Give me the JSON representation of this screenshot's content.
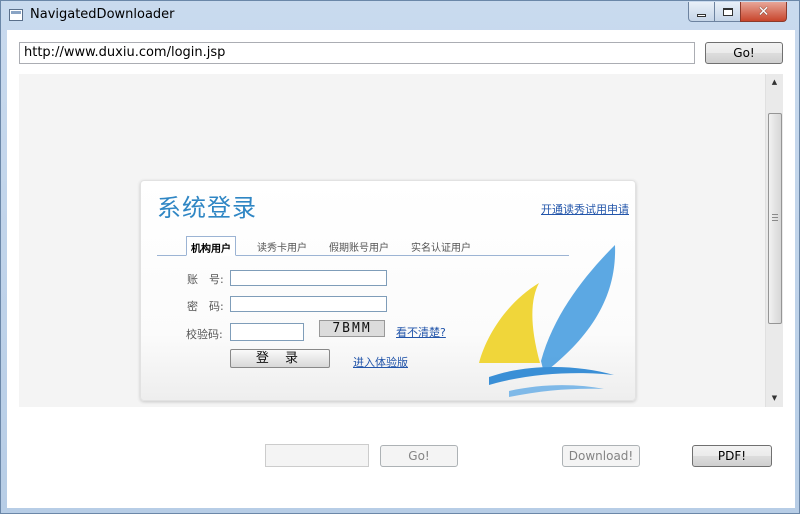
{
  "window": {
    "title": "NavigatedDownloader",
    "minimize_icon": "minimize-icon",
    "maximize_icon": "maximize-icon",
    "close_icon": "close-icon",
    "close_glyph": "✕"
  },
  "address_bar": {
    "url": "http://www.duxiu.com/login.jsp",
    "go_label": "Go!"
  },
  "webview": {
    "scroll_up_glyph": "▲",
    "scroll_down_glyph": "▼",
    "login": {
      "title": "系统登录",
      "trial_apply_link": "开通读秀试用申请",
      "tabs": [
        {
          "label": "机构用户",
          "active": true
        },
        {
          "label": "读秀卡用户",
          "active": false
        },
        {
          "label": "假期账号用户",
          "active": false
        },
        {
          "label": "实名认证用户",
          "active": false
        }
      ],
      "account_label": "账　号:",
      "password_label": "密　码:",
      "captcha_label": "校验码:",
      "captcha_text": "7BMM",
      "unclear_link": "看不清楚?",
      "login_button": "登 录",
      "trial_version_link": "进入体验版"
    }
  },
  "bottom_bar": {
    "page_input_value": "",
    "go_label": "Go!",
    "download_label": "Download!",
    "pdf_label": "PDF!"
  },
  "colors": {
    "title_blue": "#2f86c4",
    "link_blue": "#2255aa",
    "logo_blue": "#4a9ee0",
    "logo_yellow": "#f0d63a"
  }
}
